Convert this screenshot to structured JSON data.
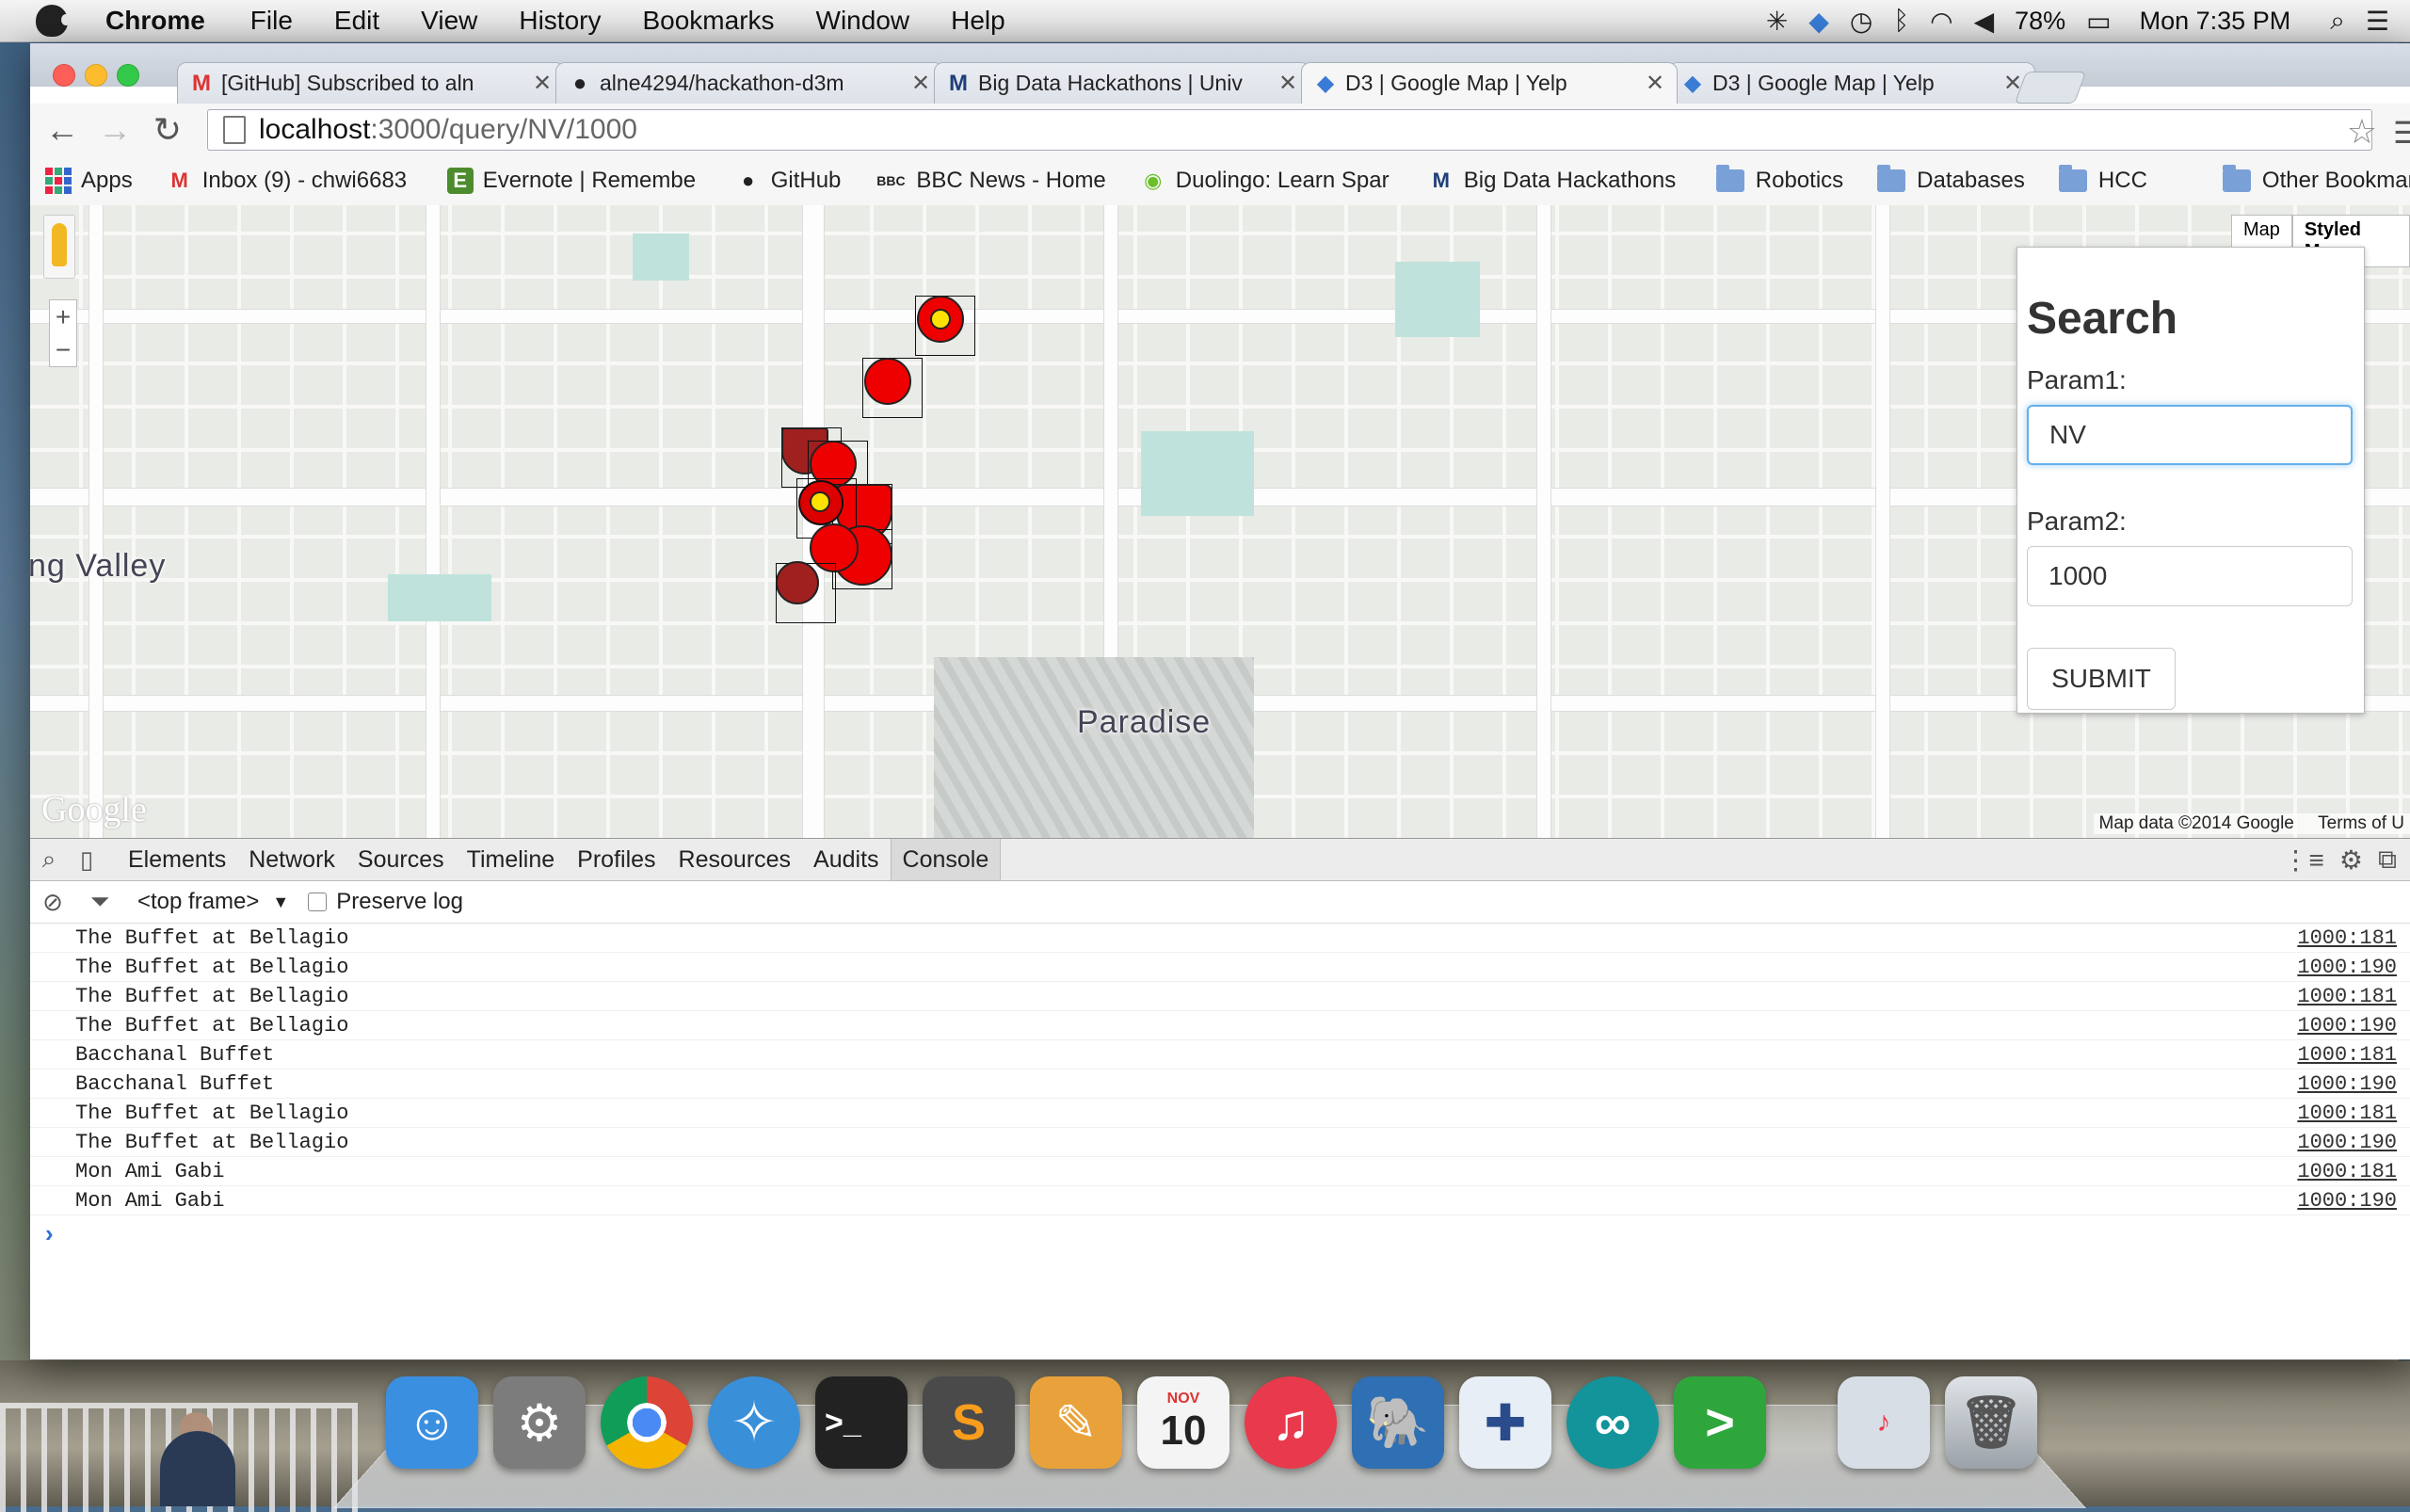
{
  "menubar": {
    "app": "Chrome",
    "items": [
      "File",
      "Edit",
      "View",
      "History",
      "Bookmarks",
      "Window",
      "Help"
    ],
    "battery": "78%",
    "clock": "Mon 7:35 PM"
  },
  "tabs": [
    {
      "title": "[GitHub] Subscribed to aln",
      "icon": "gmail-icon"
    },
    {
      "title": "alne4294/hackathon-d3m",
      "icon": "github-icon"
    },
    {
      "title": "Big Data Hackathons | Univ",
      "icon": "m-icon"
    },
    {
      "title": "D3 | Google Map | Yelp",
      "icon": "d3-icon"
    },
    {
      "title": "D3 | Google Map | Yelp",
      "icon": "d3-icon"
    }
  ],
  "address": {
    "host": "localhost",
    "rest": ":3000/query/NV/1000"
  },
  "bookmarks": [
    {
      "label": "Apps",
      "icon": "apps-icon"
    },
    {
      "label": "Inbox (9) - chwi6683",
      "icon": "gmail-icon"
    },
    {
      "label": "Evernote | Remembe",
      "icon": "evernote-icon"
    },
    {
      "label": "GitHub",
      "icon": "github-icon"
    },
    {
      "label": "BBC News - Home",
      "icon": "bbc-icon"
    },
    {
      "label": "Duolingo: Learn Spar",
      "icon": "duolingo-icon"
    },
    {
      "label": "Big Data Hackathons",
      "icon": "m-icon"
    },
    {
      "label": "Robotics",
      "icon": "folder-icon"
    },
    {
      "label": "Databases",
      "icon": "folder-icon"
    },
    {
      "label": "HCC",
      "icon": "folder-icon"
    },
    {
      "label": "Other Bookmarks",
      "icon": "folder-icon"
    }
  ],
  "map": {
    "labels": {
      "valley": "ng Valley",
      "paradise": "Paradise"
    },
    "maptype": {
      "map": "Map",
      "styled": "Styled Map"
    },
    "credit": "Map data ©2014 Google",
    "terms": "Terms of U",
    "logo": "Google"
  },
  "search": {
    "title": "Search",
    "param1_label": "Param1:",
    "param1_value": "NV",
    "param2_label": "Param2:",
    "param2_value": "1000",
    "submit_label": "SUBMIT"
  },
  "devtools": {
    "tabs": [
      "Elements",
      "Network",
      "Sources",
      "Timeline",
      "Profiles",
      "Resources",
      "Audits",
      "Console"
    ],
    "active_tab": "Console",
    "frame": "<top frame>",
    "preserve_log": "Preserve log",
    "logs": [
      {
        "msg": "The Buffet at Bellagio",
        "src": "1000:181"
      },
      {
        "msg": "The Buffet at Bellagio",
        "src": "1000:190"
      },
      {
        "msg": "The Buffet at Bellagio",
        "src": "1000:181"
      },
      {
        "msg": "The Buffet at Bellagio",
        "src": "1000:190"
      },
      {
        "msg": "Bacchanal Buffet",
        "src": "1000:181"
      },
      {
        "msg": "Bacchanal Buffet",
        "src": "1000:190"
      },
      {
        "msg": "The Buffet at Bellagio",
        "src": "1000:181"
      },
      {
        "msg": "The Buffet at Bellagio",
        "src": "1000:190"
      },
      {
        "msg": "Mon Ami Gabi",
        "src": "1000:181"
      },
      {
        "msg": "Mon Ami Gabi",
        "src": "1000:190"
      }
    ],
    "prompt": "›"
  },
  "dock": {
    "apps": [
      {
        "name": "finder-icon",
        "color": "#3b8fe0"
      },
      {
        "name": "system-preferences-icon",
        "color": "#7c7c7c"
      },
      {
        "name": "chrome-icon",
        "color": "#e0e0e0"
      },
      {
        "name": "safari-icon",
        "color": "#3a8fd9"
      },
      {
        "name": "terminal-icon",
        "color": "#222222"
      },
      {
        "name": "sublime-text-icon",
        "color": "#4a4a4a"
      },
      {
        "name": "pages-icon",
        "color": "#e9a23b"
      },
      {
        "name": "calendar-icon",
        "color": "#f4f4f4"
      },
      {
        "name": "itunes-icon",
        "color": "#e83a4c"
      },
      {
        "name": "postgres-icon",
        "color": "#2f6fb3"
      },
      {
        "name": "tableau-icon",
        "color": "#e8eef5"
      },
      {
        "name": "arduino-icon",
        "color": "#12949a"
      },
      {
        "name": "prompt-icon",
        "color": "#2fa63c"
      },
      {
        "name": "itunes-window-icon",
        "color": "#d8dee6"
      },
      {
        "name": "trash-icon",
        "color": "#b9bfc6"
      }
    ],
    "calendar_month": "NOV",
    "calendar_day": "10"
  }
}
